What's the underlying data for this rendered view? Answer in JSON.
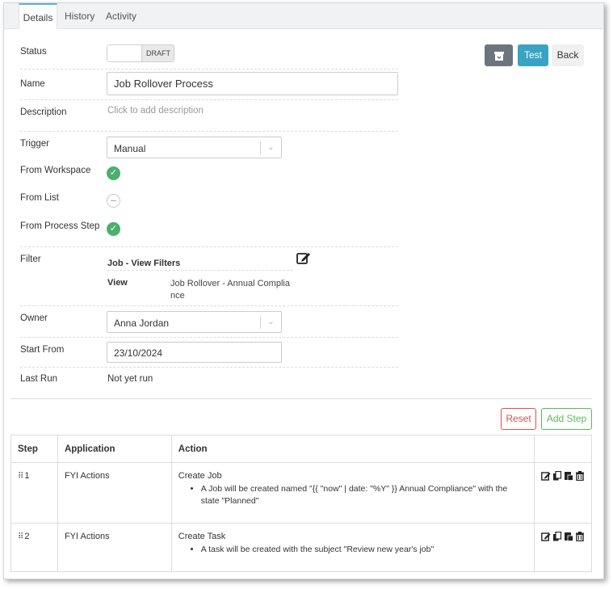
{
  "tabs": [
    {
      "label": "Details"
    },
    {
      "label": "History"
    },
    {
      "label": "Activity"
    }
  ],
  "form": {
    "status": {
      "label": "Status",
      "value": "DRAFT"
    },
    "name": {
      "label": "Name",
      "value": "Job Rollover Process"
    },
    "description": {
      "label": "Description",
      "placeholder": "Click to add description"
    },
    "trigger": {
      "label": "Trigger",
      "value": "Manual"
    },
    "from_workspace": {
      "label": "From Workspace",
      "checked": true
    },
    "from_list": {
      "label": "From List",
      "checked": false
    },
    "from_process_step": {
      "label": "From Process Step",
      "checked": true
    },
    "filter": {
      "label": "Filter",
      "title": "Job - View Filters",
      "view_label": "View",
      "view_value_line1": "Job Rollover - Annual Complia",
      "view_value_line2": "nce"
    },
    "owner": {
      "label": "Owner",
      "value": "Anna Jordan"
    },
    "start_from": {
      "label": "Start From",
      "value": "23/10/2024"
    },
    "last_run": {
      "label": "Last Run",
      "value": "Not yet run"
    }
  },
  "actions": {
    "test_label": "Test",
    "back_label": "Back",
    "reset_label": "Reset",
    "add_step_label": "Add Step"
  },
  "steps_table": {
    "headers": {
      "step": "Step",
      "application": "Application",
      "action": "Action"
    },
    "rows": [
      {
        "step": "1",
        "application": "FYI Actions",
        "action_title": "Create Job",
        "action_detail": "A Job will be created named \"{{ \"now\" | date: \"%Y\" }} Annual Compliance\" with the state \"Planned\""
      },
      {
        "step": "2",
        "application": "FYI Actions",
        "action_title": "Create Task",
        "action_detail": "A task will be created with the subject \"Review new year's job\""
      }
    ]
  },
  "colors": {
    "test_button": "#3aa3c3",
    "archive_button": "#6c757d",
    "check_green": "#4caf6e",
    "reset_red": "#d9534f",
    "add_step_green": "#5cb85c"
  }
}
